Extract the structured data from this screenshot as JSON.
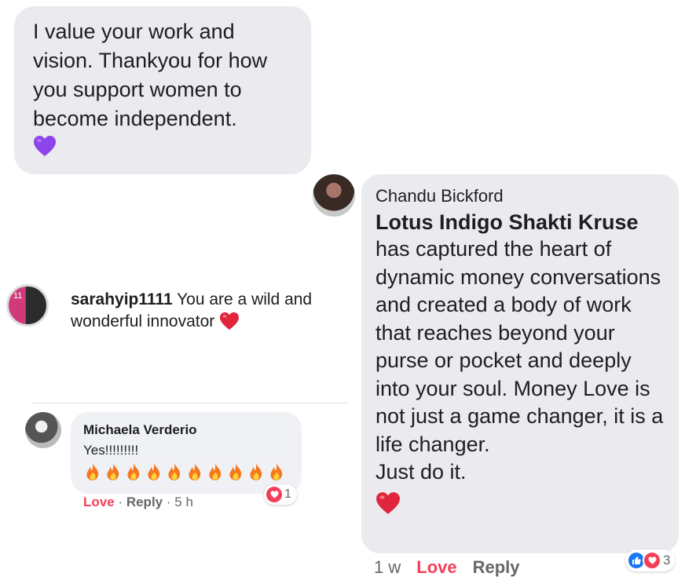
{
  "top_message": {
    "text": "I value your work and vision. Thankyou for how you support women to become independent.",
    "emoji": "purple-heart"
  },
  "chandu_comment": {
    "author": "Chandu Bickford",
    "mention": "Lotus Indigo Shakti Kruse",
    "body": "has captured the heart of dynamic money conversations and created a body of work that reaches beyond your purse or pocket and deeply into your soul. Money Love is not just a game changer, it is a life changer.",
    "closing": "Just do it.",
    "emoji": "red-heart",
    "time": "1 w",
    "love_label": "Love",
    "reply_label": "Reply",
    "reaction_count": "3"
  },
  "sarah_comment": {
    "username": "sarahyip1111",
    "text": "You are a wild and wonderful innovator",
    "emoji": "red-heart",
    "avatar_badge": "11"
  },
  "michaela_comment": {
    "author": "Michaela Verderio",
    "text": "Yes!!!!!!!!!",
    "fire_count": 10,
    "love_label": "Love",
    "separator1": "·",
    "reply_label": "Reply",
    "separator2": "·",
    "time": "5 h",
    "reaction_count": "1"
  },
  "colors": {
    "bubble": "#ebebef",
    "love": "#f33e58",
    "like": "#1877f2",
    "muted": "#65676b",
    "purple_heart": "#8e44ec"
  }
}
